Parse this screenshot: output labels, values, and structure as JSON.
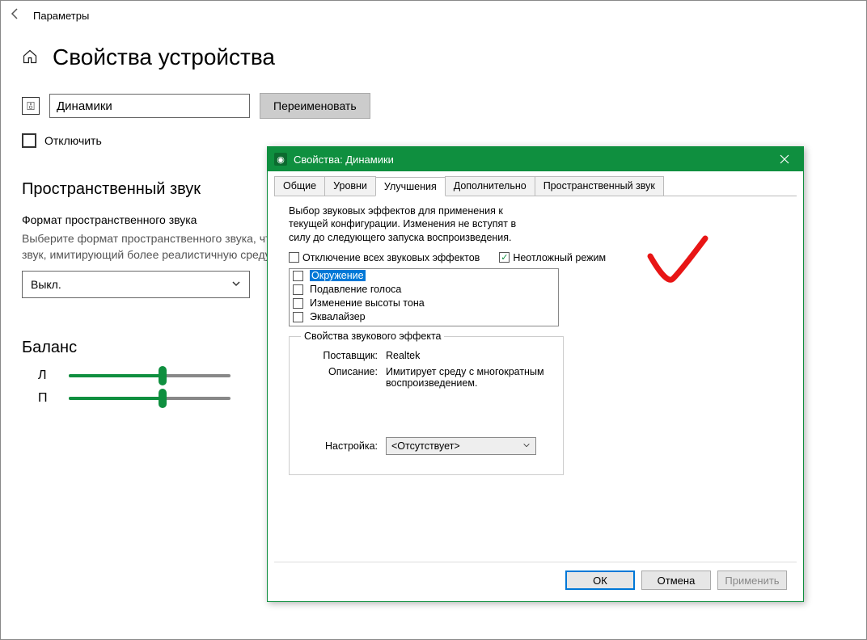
{
  "settings": {
    "header_title": "Параметры",
    "page_title": "Свойства устройства",
    "device_name": "Динамики",
    "rename_btn": "Переименовать",
    "disable_label": "Отключить",
    "spatial_heading": "Пространственный звук",
    "spatial_format_heading": "Формат пространственного звука",
    "spatial_desc": "Выберите формат пространственного звука, чтобы слышать объемный звук, имитирующий более реалистичную среду.",
    "spatial_selected": "Выкл.",
    "balance_heading": "Баланс",
    "balance_left": "Л",
    "balance_right": "П"
  },
  "dialog": {
    "title": "Свойства: Динамики",
    "tabs": {
      "general": "Общие",
      "levels": "Уровни",
      "enhancements": "Улучшения",
      "advanced": "Дополнительно",
      "spatial": "Пространственный звук"
    },
    "intro": "Выбор звуковых эффектов для применения к текущей конфигурации. Изменения не вступят в силу до следующего запуска воспроизведения.",
    "disable_all": "Отключение всех звуковых эффектов",
    "immediate_mode": "Неотложный режим",
    "effects": {
      "environment": "Окружение",
      "voice_cancel": "Подавление голоса",
      "pitch_shift": "Изменение высоты тона",
      "equalizer": "Эквалайзер"
    },
    "fieldset_title": "Свойства звукового эффекта",
    "provider_label": "Поставщик:",
    "provider_value": "Realtek",
    "description_label": "Описание:",
    "description_value": "Имитирует среду с многократным воспроизведением.",
    "setting_label": "Настройка:",
    "setting_value": "<Отсутствует>",
    "buttons": {
      "ok": "ОК",
      "cancel": "Отмена",
      "apply": "Применить"
    }
  }
}
